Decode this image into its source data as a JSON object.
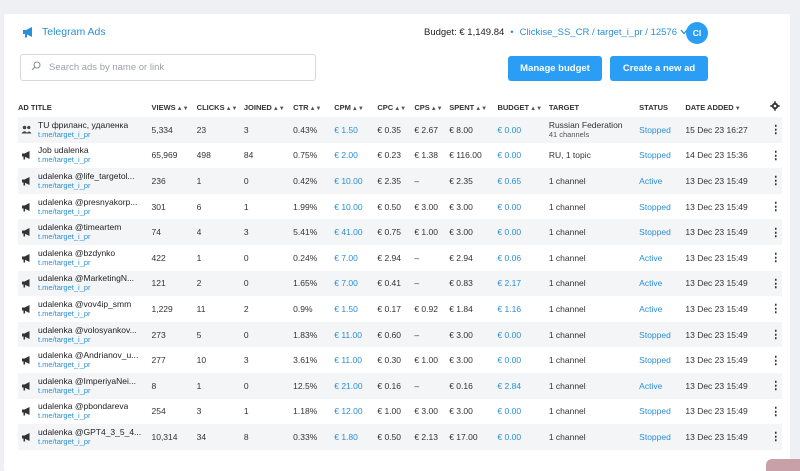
{
  "app": {
    "title": "Telegram Ads"
  },
  "header": {
    "budget_label": "Budget: € 1,149.84",
    "separator": "•",
    "account": "Clickise_SS_CR / target_i_pr / 12576",
    "avatar_initials": "CI"
  },
  "search": {
    "placeholder": "Search ads by name or link"
  },
  "buttons": {
    "manage_budget": "Manage budget",
    "create_ad": "Create a new ad"
  },
  "table": {
    "columns": [
      "AD TITLE",
      "VIEWS",
      "CLICKS",
      "JOINED",
      "CTR",
      "CPM",
      "CPC",
      "CPS",
      "SPENT",
      "BUDGET",
      "TARGET",
      "STATUS",
      "DATE ADDED"
    ],
    "rows": [
      {
        "icon": "group",
        "title": "TU фриланс, удаленка",
        "link": "t.me/target_i_pr",
        "views": "5,334",
        "clicks": "23",
        "joined": "3",
        "ctr": "0.43%",
        "cpm": "€ 1.50",
        "cpc": "€ 0.35",
        "cps": "€ 2.67",
        "spent": "€ 8.00",
        "budget": "€ 0.00",
        "target": "Russian Federation",
        "target_sub": "41 channels",
        "status": "Stopped",
        "date": "15 Dec 23 16:27"
      },
      {
        "icon": "megaphone",
        "title": "Job udalenka",
        "link": "t.me/target_i_pr",
        "views": "65,969",
        "clicks": "498",
        "joined": "84",
        "ctr": "0.75%",
        "cpm": "€ 2.00",
        "cpc": "€ 0.23",
        "cps": "€ 1.38",
        "spent": "€ 116.00",
        "budget": "€ 0.00",
        "target": "RU, 1 topic",
        "target_sub": "",
        "status": "Stopped",
        "date": "14 Dec 23 15:36"
      },
      {
        "icon": "megaphone",
        "title": "udalenka @life_targetol...",
        "link": "t.me/target_i_pr",
        "views": "236",
        "clicks": "1",
        "joined": "0",
        "ctr": "0.42%",
        "cpm": "€ 10.00",
        "cpc": "€ 2.35",
        "cps": "–",
        "spent": "€ 2.35",
        "budget": "€ 0.65",
        "target": "1 channel",
        "target_sub": "",
        "status": "Active",
        "date": "13 Dec 23 15:49"
      },
      {
        "icon": "megaphone",
        "title": "udalenka @presnyakorp...",
        "link": "t.me/target_i_pr",
        "views": "301",
        "clicks": "6",
        "joined": "1",
        "ctr": "1.99%",
        "cpm": "€ 10.00",
        "cpc": "€ 0.50",
        "cps": "€ 3.00",
        "spent": "€ 3.00",
        "budget": "€ 0.00",
        "target": "1 channel",
        "target_sub": "",
        "status": "Stopped",
        "date": "13 Dec 23 15:49"
      },
      {
        "icon": "megaphone",
        "title": "udalenka @timeartem",
        "link": "t.me/target_i_pr",
        "views": "74",
        "clicks": "4",
        "joined": "3",
        "ctr": "5.41%",
        "cpm": "€ 41.00",
        "cpc": "€ 0.75",
        "cps": "€ 1.00",
        "spent": "€ 3.00",
        "budget": "€ 0.00",
        "target": "1 channel",
        "target_sub": "",
        "status": "Stopped",
        "date": "13 Dec 23 15:49"
      },
      {
        "icon": "megaphone",
        "title": "udalenka @bzdynko",
        "link": "t.me/target_i_pr",
        "views": "422",
        "clicks": "1",
        "joined": "0",
        "ctr": "0.24%",
        "cpm": "€ 7.00",
        "cpc": "€ 2.94",
        "cps": "–",
        "spent": "€ 2.94",
        "budget": "€ 0.06",
        "target": "1 channel",
        "target_sub": "",
        "status": "Active",
        "date": "13 Dec 23 15:49"
      },
      {
        "icon": "megaphone",
        "title": "udalenka @MarketingN...",
        "link": "t.me/target_i_pr",
        "views": "121",
        "clicks": "2",
        "joined": "0",
        "ctr": "1.65%",
        "cpm": "€ 7.00",
        "cpc": "€ 0.41",
        "cps": "–",
        "spent": "€ 0.83",
        "budget": "€ 2.17",
        "target": "1 channel",
        "target_sub": "",
        "status": "Active",
        "date": "13 Dec 23 15:49"
      },
      {
        "icon": "megaphone",
        "title": "udalenka @vov4ip_smm",
        "link": "t.me/target_i_pr",
        "views": "1,229",
        "clicks": "11",
        "joined": "2",
        "ctr": "0.9%",
        "cpm": "€ 1.50",
        "cpc": "€ 0.17",
        "cps": "€ 0.92",
        "spent": "€ 1.84",
        "budget": "€ 1.16",
        "target": "1 channel",
        "target_sub": "",
        "status": "Active",
        "date": "13 Dec 23 15:49"
      },
      {
        "icon": "megaphone",
        "title": "udalenka @volosyankov...",
        "link": "t.me/target_i_pr",
        "views": "273",
        "clicks": "5",
        "joined": "0",
        "ctr": "1.83%",
        "cpm": "€ 11.00",
        "cpc": "€ 0.60",
        "cps": "–",
        "spent": "€ 3.00",
        "budget": "€ 0.00",
        "target": "1 channel",
        "target_sub": "",
        "status": "Stopped",
        "date": "13 Dec 23 15:49"
      },
      {
        "icon": "megaphone",
        "title": "udalenka @Andrianov_u...",
        "link": "t.me/target_i_pr",
        "views": "277",
        "clicks": "10",
        "joined": "3",
        "ctr": "3.61%",
        "cpm": "€ 11.00",
        "cpc": "€ 0.30",
        "cps": "€ 1.00",
        "spent": "€ 3.00",
        "budget": "€ 0.00",
        "target": "1 channel",
        "target_sub": "",
        "status": "Stopped",
        "date": "13 Dec 23 15:49"
      },
      {
        "icon": "megaphone",
        "title": "udalenka @ImperiyaNei...",
        "link": "t.me/target_i_pr",
        "views": "8",
        "clicks": "1",
        "joined": "0",
        "ctr": "12.5%",
        "cpm": "€ 21.00",
        "cpc": "€ 0.16",
        "cps": "–",
        "spent": "€ 0.16",
        "budget": "€ 2.84",
        "target": "1 channel",
        "target_sub": "",
        "status": "Active",
        "date": "13 Dec 23 15:49"
      },
      {
        "icon": "megaphone",
        "title": "udalenka @pbondareva",
        "link": "t.me/target_i_pr",
        "views": "254",
        "clicks": "3",
        "joined": "1",
        "ctr": "1.18%",
        "cpm": "€ 12.00",
        "cpc": "€ 1.00",
        "cps": "€ 3.00",
        "spent": "€ 3.00",
        "budget": "€ 0.00",
        "target": "1 channel",
        "target_sub": "",
        "status": "Stopped",
        "date": "13 Dec 23 15:49"
      },
      {
        "icon": "megaphone",
        "title": "udalenka @GPT4_3_5_4...",
        "link": "t.me/target_i_pr",
        "views": "10,314",
        "clicks": "34",
        "joined": "8",
        "ctr": "0.33%",
        "cpm": "€ 1.80",
        "cpc": "€ 0.50",
        "cps": "€ 2.13",
        "spent": "€ 17.00",
        "budget": "€ 0.00",
        "target": "1 channel",
        "target_sub": "",
        "status": "Stopped",
        "date": "13 Dec 23 15:49"
      }
    ]
  },
  "colors": {
    "accent": "#2a9df4",
    "link": "#2a8fd4"
  }
}
